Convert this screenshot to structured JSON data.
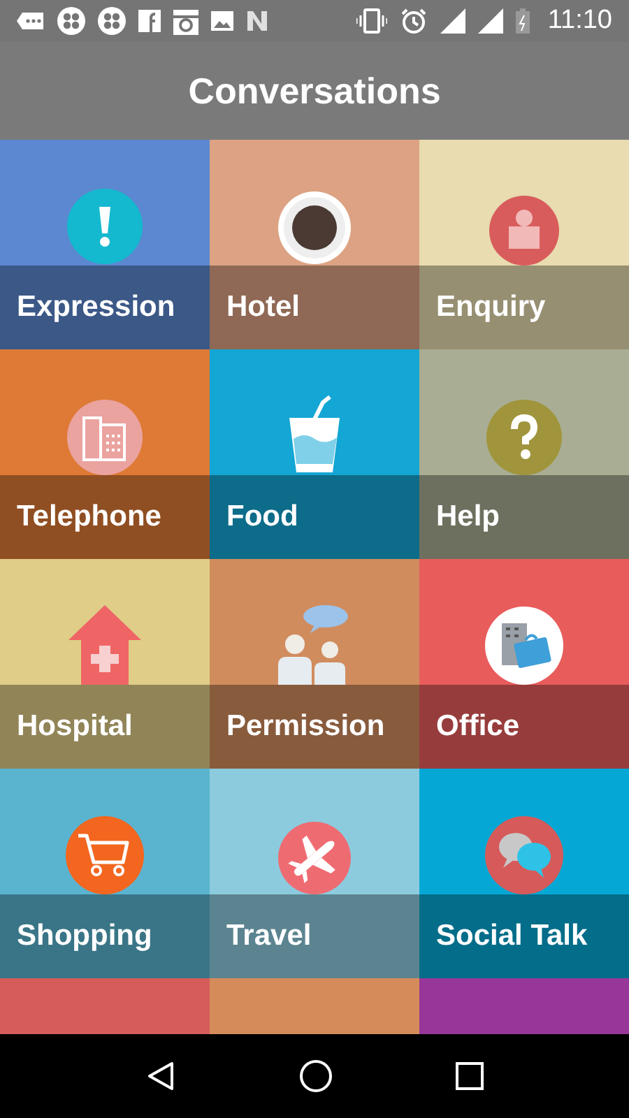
{
  "status_bar": {
    "time": "11:10"
  },
  "title": "Conversations",
  "tiles": [
    {
      "label": "Expression",
      "color": "#5b88d0"
    },
    {
      "label": "Hotel",
      "color": "#dca283"
    },
    {
      "label": "Enquiry",
      "color": "#e8dcb0"
    },
    {
      "label": "Telephone",
      "color": "#de7a35"
    },
    {
      "label": "Food",
      "color": "#14a6d4"
    },
    {
      "label": "Help",
      "color": "#a9ad93"
    },
    {
      "label": "Hospital",
      "color": "#dfcd88"
    },
    {
      "label": "Permission",
      "color": "#d18c5e"
    },
    {
      "label": "Office",
      "color": "#e85c5c"
    },
    {
      "label": "Shopping",
      "color": "#5ab4d0"
    },
    {
      "label": "Travel",
      "color": "#8ccbdd"
    },
    {
      "label": "Social Talk",
      "color": "#05a8d5"
    }
  ],
  "more_tiles": [
    {
      "color": "#d65c5c"
    },
    {
      "color": "#d58c5a"
    },
    {
      "color": "#98379a"
    }
  ]
}
